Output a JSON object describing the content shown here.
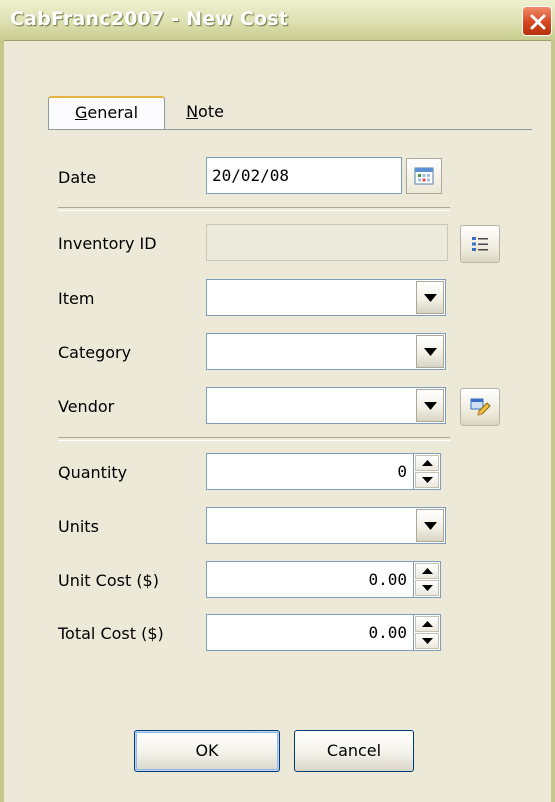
{
  "window": {
    "title": "CabFranc2007 - New Cost"
  },
  "tabs": [
    {
      "label": "General",
      "accel": "G",
      "rest": "eneral",
      "active": true
    },
    {
      "label": "Note",
      "accel": "N",
      "rest": "ote",
      "active": false
    }
  ],
  "form": {
    "date": {
      "label": "Date",
      "value": "20/02/08"
    },
    "inventory_id": {
      "label": "Inventory ID",
      "value": ""
    },
    "item": {
      "label": "Item",
      "value": ""
    },
    "category": {
      "label": "Category",
      "value": ""
    },
    "vendor": {
      "label": "Vendor",
      "value": ""
    },
    "quantity": {
      "label": "Quantity",
      "value": "0"
    },
    "units": {
      "label": "Units",
      "value": ""
    },
    "unit_cost": {
      "label": "Unit Cost ($)",
      "value": "0.00"
    },
    "total_cost": {
      "label": "Total Cost ($)",
      "value": "0.00"
    }
  },
  "buttons": {
    "ok": "OK",
    "cancel": "Cancel"
  },
  "icons": {
    "close": "close-icon",
    "calendar": "calendar-icon",
    "list": "list-icon",
    "edit": "edit-icon",
    "dropdown": "chevron-down-icon",
    "spin_up": "arrow-up-icon",
    "spin_down": "arrow-down-icon"
  },
  "colors": {
    "window_bg": "#ece9d8",
    "titlebar": "#dfe2b4",
    "close_button": "#d4471f",
    "field_border": "#7f9db9",
    "tab_accent": "#e6b23e"
  }
}
